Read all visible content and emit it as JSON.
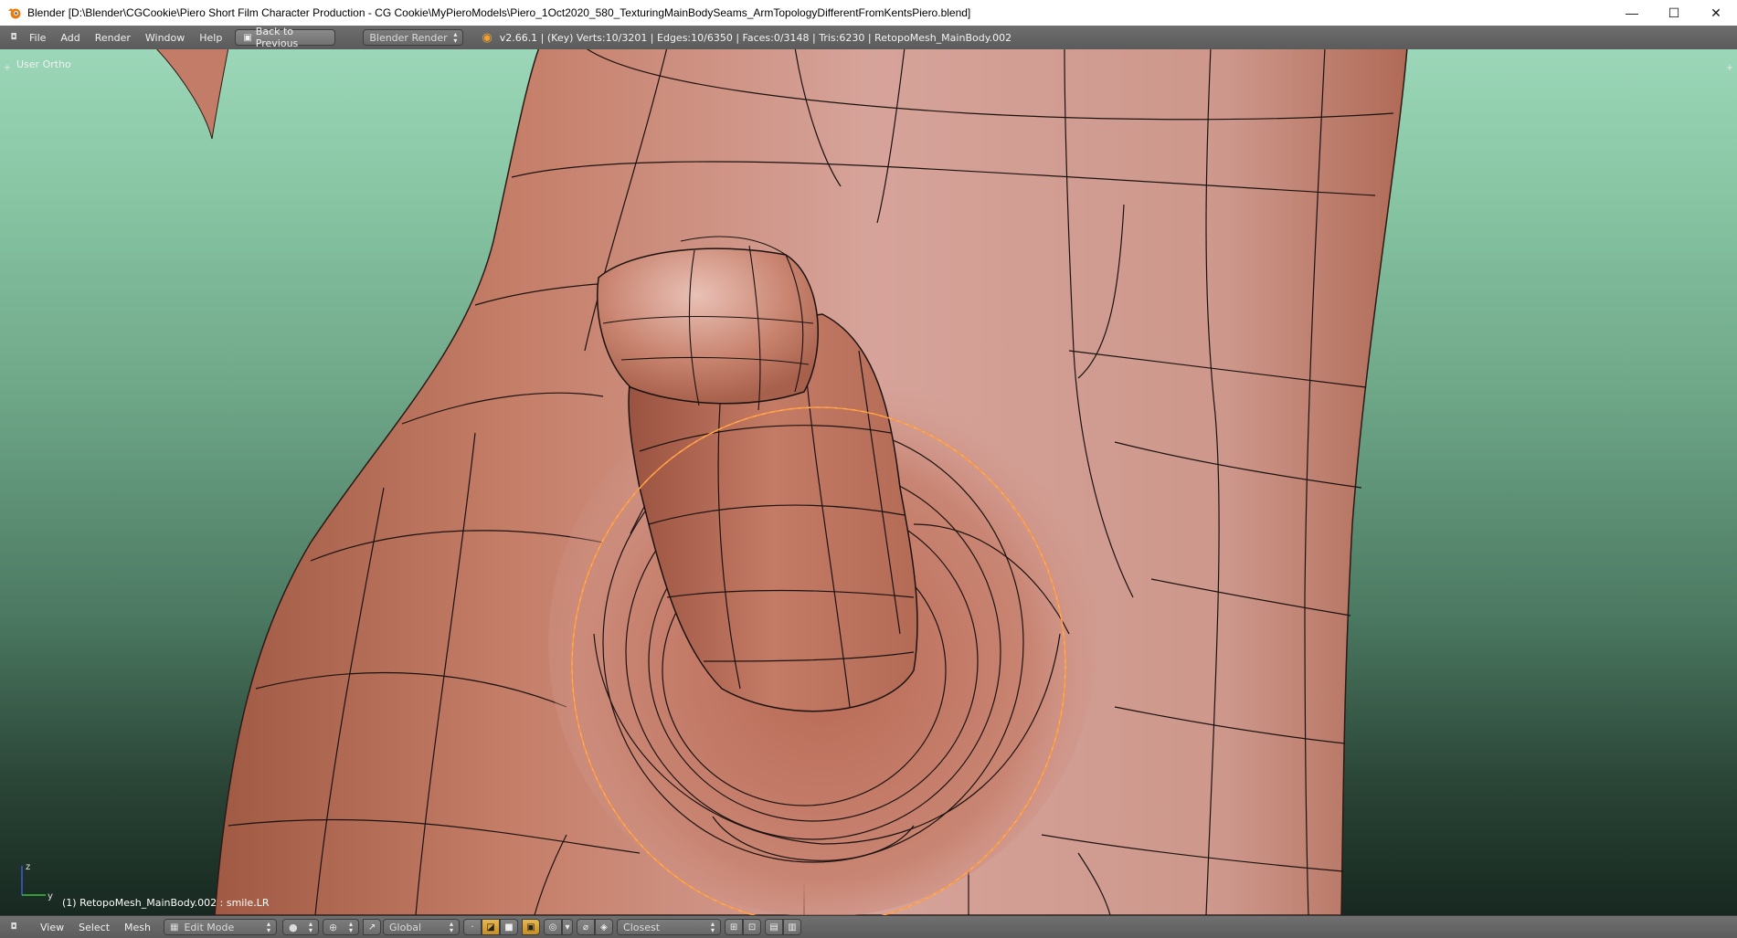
{
  "window": {
    "title": "Blender [D:\\Blender\\CGCookie\\Piero Short Film Character Production - CG Cookie\\MyPieroModels\\Piero_1Oct2020_580_TexturingMainBodySeams_ArmTopologyDifferentFromKentsPiero.blend]",
    "minimize": "—",
    "maximize": "☐",
    "close": "✕"
  },
  "infobar": {
    "menus": [
      "File",
      "Add",
      "Render",
      "Window",
      "Help"
    ],
    "back_button": "Back to Previous",
    "render_engine": "Blender Render",
    "stats": "v2.66.1 | (Key) Verts:10/3201 | Edges:10/6350 | Faces:0/3148 | Tris:6230 | RetopoMesh_MainBody.002"
  },
  "viewport": {
    "view_label": "User Ortho",
    "object_label": "(1) RetopoMesh_MainBody.002 : smile.LR",
    "axis_z": "z",
    "axis_y": "y"
  },
  "viewheader": {
    "menus": [
      "View",
      "Select",
      "Mesh"
    ],
    "mode": "Edit Mode",
    "orientation": "Global",
    "snap_target": "Closest"
  },
  "colors": {
    "mesh": "#c8846e",
    "selection": "#ff9a3c",
    "bg_top": "#9bd7b8",
    "bg_bottom": "#172820"
  }
}
